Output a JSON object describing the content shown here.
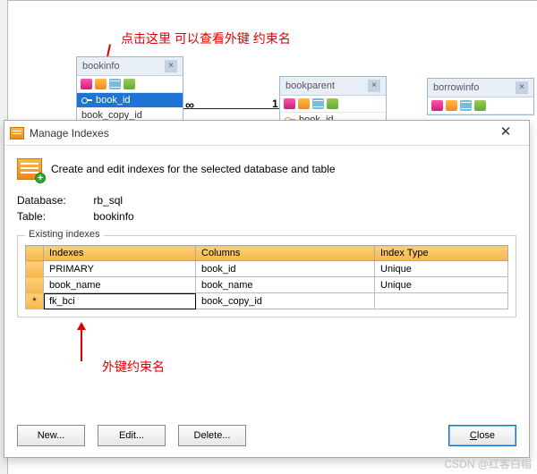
{
  "annotations": {
    "top": "点击这里  可以查看外键 约束名",
    "bottom": "外键约束名"
  },
  "entities": {
    "bookinfo": {
      "title": "bookinfo",
      "rows": [
        "book_id",
        "book_copy_id"
      ],
      "selectedIndex": 0
    },
    "bookparent": {
      "title": "bookparent",
      "rows": [
        "book_id"
      ]
    },
    "borrowinfo": {
      "title": "borrowinfo",
      "rows": []
    }
  },
  "relation": {
    "leftCard": "∞",
    "rightCard": "1"
  },
  "dialog": {
    "title": "Manage Indexes",
    "description": "Create and edit indexes for the selected database and table",
    "database_label": "Database:",
    "database_value": "rb_sql",
    "table_label": "Table:",
    "table_value": "bookinfo",
    "group_title": "Existing indexes",
    "headers": {
      "indexes": "Indexes",
      "columns": "Columns",
      "type": "Index Type"
    },
    "rows": [
      {
        "marker": "",
        "name": "PRIMARY",
        "columns": "book_id",
        "type": "Unique"
      },
      {
        "marker": "",
        "name": "book_name",
        "columns": "book_name",
        "type": "Unique"
      },
      {
        "marker": "*",
        "name": "fk_bci",
        "columns": "book_copy_id",
        "type": ""
      }
    ],
    "buttons": {
      "new": "New...",
      "edit": "Edit...",
      "delete": "Delete...",
      "close": "Close"
    }
  },
  "watermark": "CSDN @红客白帽"
}
